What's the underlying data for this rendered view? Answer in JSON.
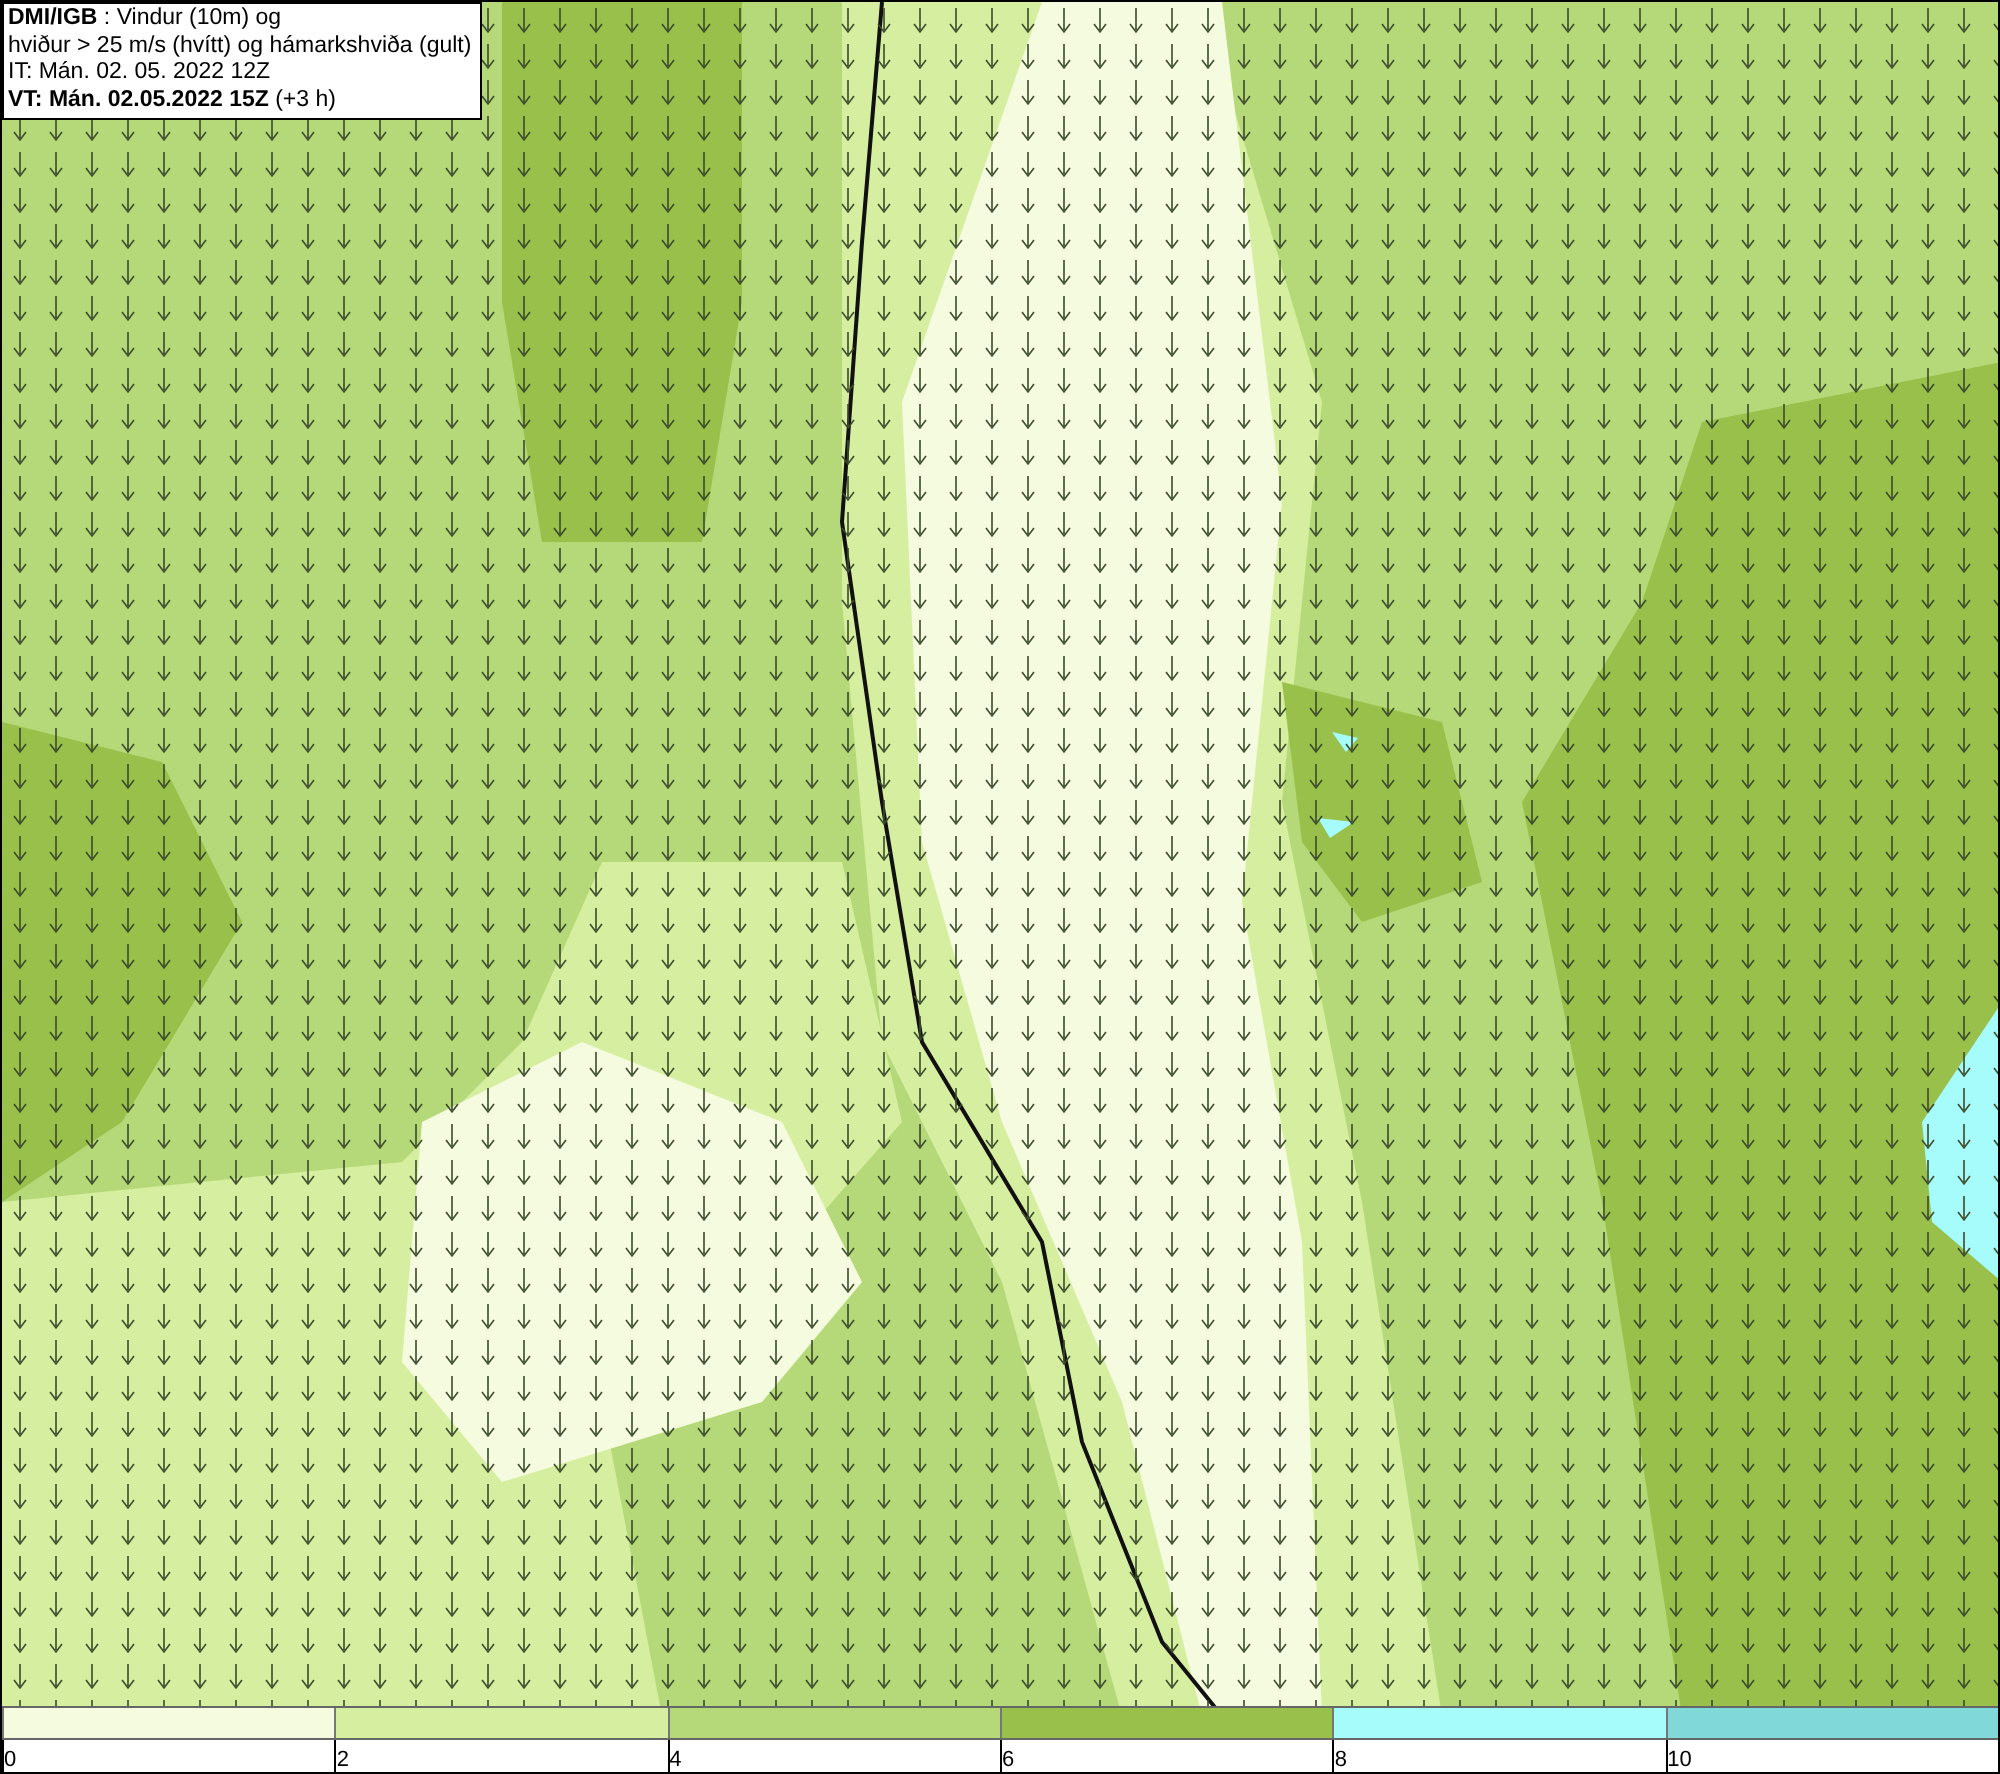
{
  "legend": {
    "lines": [
      "**DMI/IGB** : Vindur (10m) og",
      "hviður > 25 m/s (hvítt) og hámarkshviða (gult)",
      "IT: Mán. 02. 05. 2022 12Z",
      "**VT: Mán. 02.05.2022 15Z** (+3 h)"
    ]
  },
  "colorbar": {
    "segments": [
      {
        "color": "#f5fbdf",
        "label": "0"
      },
      {
        "color": "#d6eea0",
        "label": "2"
      },
      {
        "color": "#b5d978",
        "label": "4"
      },
      {
        "color": "#98c04a",
        "label": "6"
      },
      {
        "color": "#a6fbfb",
        "label": "8"
      },
      {
        "color": "#80d8d8",
        "label": "10"
      }
    ]
  }
}
